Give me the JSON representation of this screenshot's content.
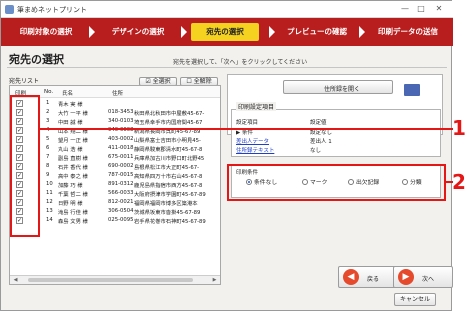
{
  "window": {
    "title": "筆まめネットプリント",
    "minimize": "—",
    "maximize": "□",
    "close": "✕"
  },
  "steps": [
    {
      "label": "印刷対象の選択"
    },
    {
      "label": "デザインの選択"
    },
    {
      "label": "宛先の選択"
    },
    {
      "label": "プレビューの確認"
    },
    {
      "label": "印刷データの送信"
    }
  ],
  "page": {
    "title": "宛先の選択",
    "instruction": "宛先を選択して、「次へ」をクリックしてください"
  },
  "address_list": {
    "label": "宛先リスト",
    "select_all": "☑ 全選択",
    "deselect_all": "☐ 全解除",
    "columns": {
      "print": "印刷",
      "no": "No.",
      "name": "氏名",
      "address": "住所"
    },
    "rows": [
      {
        "no": "1",
        "name": "青木 実 様",
        "zip": "",
        "address": ""
      },
      {
        "no": "2",
        "name": "大竹 一平 様",
        "zip": "018-3453",
        "address": "秋田県北秋田市中屋敷45-67-"
      },
      {
        "no": "3",
        "name": "中田 誠 様",
        "zip": "340-0103",
        "address": "埼玉県幸手市内国府間45-67"
      },
      {
        "no": "4",
        "name": "山本 翔二 様",
        "zip": "940-0008",
        "address": "新潟県長岡市呉町45-67-89 "
      },
      {
        "no": "5",
        "name": "望月 一正 様",
        "zip": "403-0002",
        "address": "山梨県富士吉田市小明見45-"
      },
      {
        "no": "6",
        "name": "丸山 浩 様",
        "zip": "411-0018",
        "address": "静岡県駿東郡清水町45-67-8"
      },
      {
        "no": "7",
        "name": "副島 直樹 様",
        "zip": "675-0011",
        "address": "兵庫県加古川市野口町北野45"
      },
      {
        "no": "8",
        "name": "石井 香代 様",
        "zip": "690-0002",
        "address": "島根県松江市大正町45-67-"
      },
      {
        "no": "9",
        "name": "高中 泰之 様",
        "zip": "787-0015",
        "address": "高知県四万十市右山45-67-8"
      },
      {
        "no": "10",
        "name": "加藤 巧 様",
        "zip": "891-0312",
        "address": "鹿児島県指宿市西方45-67-8"
      },
      {
        "no": "11",
        "name": "千葉 哲二 様",
        "zip": "566-0033",
        "address": "大阪府摂津市学園町45-67-89"
      },
      {
        "no": "12",
        "name": "日野 明 様",
        "zip": "812-0021",
        "address": "福岡県福岡市博多区築港本"
      },
      {
        "no": "13",
        "name": "滝島 行佳 様",
        "zip": "306-0504",
        "address": "茨城県坂東市沓掛45-67-89"
      },
      {
        "no": "14",
        "name": "森島 文男 様",
        "zip": "025-0095",
        "address": "岩手県花巻市石神町45-67-89"
      }
    ]
  },
  "right_panel": {
    "address_book_button": "住所録を開く",
    "settings_title": "印刷設定項目",
    "settings_header_item": "設定項目",
    "settings_header_value": "設定値",
    "settings_rows": [
      {
        "item": "▶ 条件",
        "value": "設定なし"
      },
      {
        "item": "差出人データ",
        "value": "差出人 1"
      },
      {
        "item": "住所録テキスト",
        "value": "なし"
      }
    ],
    "condition_title": "印刷条件",
    "conditions": [
      {
        "label": "条件なし",
        "selected": true
      },
      {
        "label": "マーク",
        "selected": false
      },
      {
        "label": "出欠記録",
        "selected": false
      },
      {
        "label": "分類",
        "selected": false
      }
    ]
  },
  "nav": {
    "back": "戻る",
    "next": "次へ",
    "back_icon": "◀",
    "next_icon": "▶",
    "cancel": "キャンセル"
  },
  "callouts": {
    "one": "1",
    "two": "2"
  },
  "colors": {
    "step_bar": "#b91e1e",
    "step_active": "#f5d21f",
    "callout": "#e41616"
  }
}
